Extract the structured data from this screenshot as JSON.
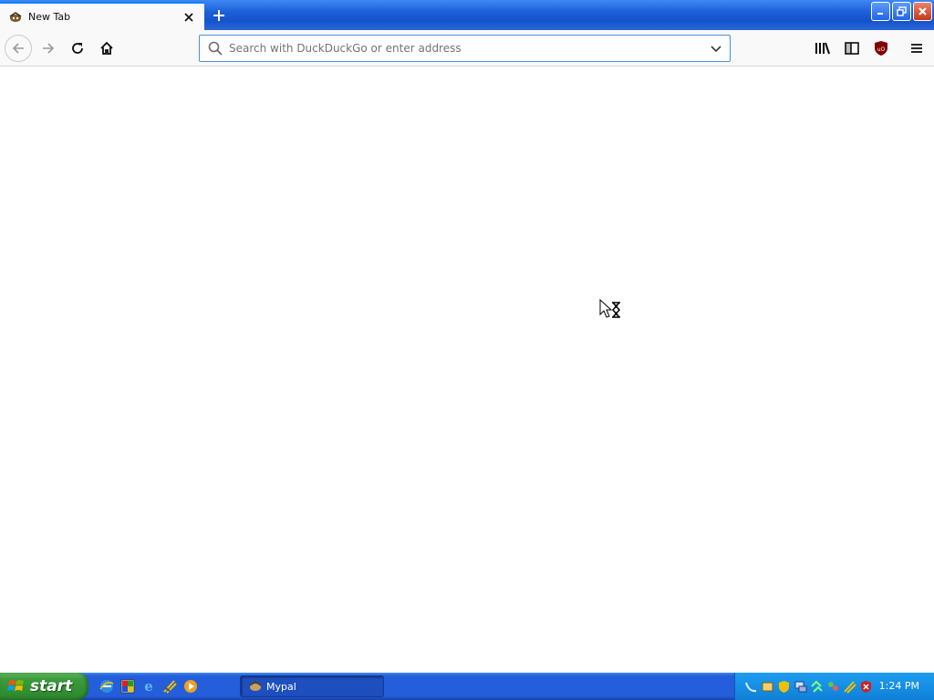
{
  "window": {
    "tab_title": "New Tab",
    "controls": [
      "minimize",
      "restore",
      "close"
    ]
  },
  "toolbar": {
    "url_placeholder": "Search with DuckDuckGo or enter address",
    "url_value": "",
    "left_buttons": [
      "back-arrow-icon",
      "forward-arrow-icon",
      "reload-icon",
      "home-icon"
    ],
    "right_buttons": [
      "library-icon",
      "sidebar-icon",
      "ublock-icon",
      "hamburger-menu-icon"
    ]
  },
  "taskbar": {
    "start_label": "start",
    "quick_launch": [
      "internet-explorer-icon",
      "paint-icon",
      "ie-icon",
      "winamp-icon",
      "media-player-icon"
    ],
    "task_button_label": "Mypal",
    "tray_icons": [
      "network-icon",
      "security-shield-icon",
      "shield-icon",
      "computer-icon",
      "network-activity-icon",
      "people-icon",
      "winamp-tray-icon",
      "antivirus-icon"
    ],
    "clock": "1:24 PM"
  },
  "colors": {
    "titlebar_blue": "#245edb",
    "start_green": "#3c9a3c",
    "url_focus": "#4a90d9",
    "ublock_red": "#800000"
  }
}
